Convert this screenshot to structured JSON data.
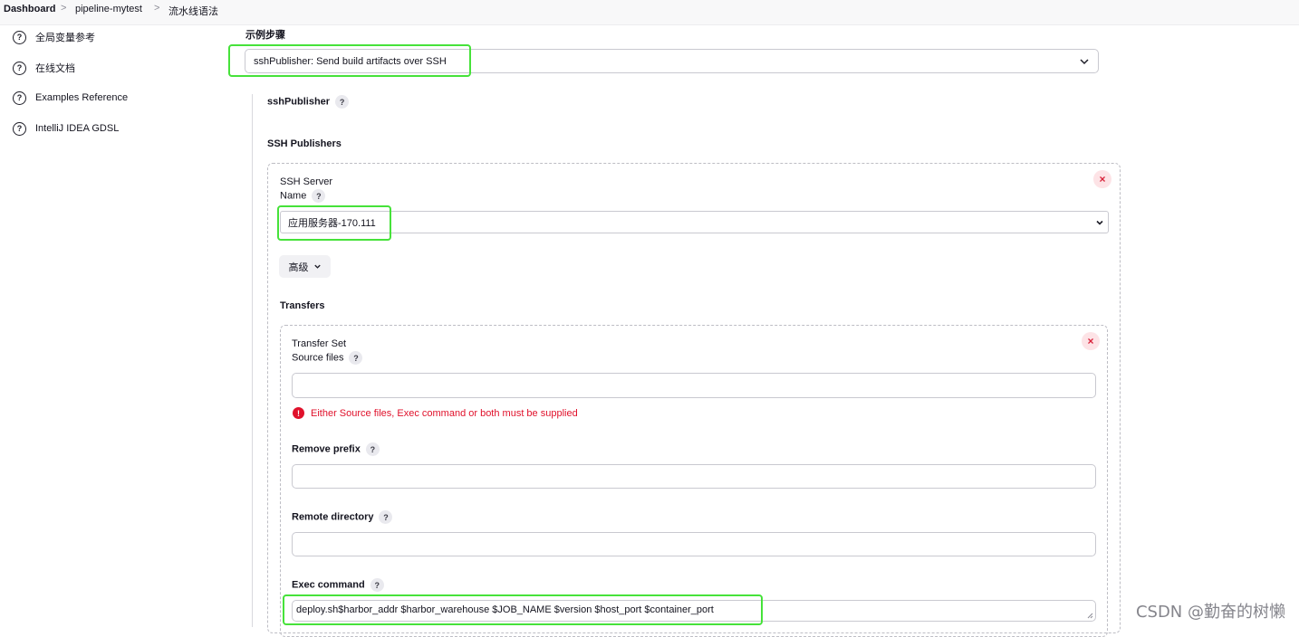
{
  "breadcrumb": {
    "items": [
      "Dashboard",
      "pipeline-mytest",
      "流水线语法"
    ],
    "separator": ">"
  },
  "sidebar": {
    "items": [
      {
        "label": "全局变量参考",
        "icon": "help-circle-icon"
      },
      {
        "label": "在线文档",
        "icon": "help-circle-icon"
      },
      {
        "label": "Examples Reference",
        "icon": "help-circle-icon"
      },
      {
        "label": "IntelliJ IDEA GDSL",
        "icon": "help-circle-icon"
      }
    ]
  },
  "sample_step": {
    "label": "示例步骤",
    "selected": "sshPublisher: Send build artifacts over SSH"
  },
  "form": {
    "step_name": "sshPublisher",
    "ssh_publishers_label": "SSH Publishers",
    "ssh_server": {
      "title": "SSH Server",
      "name_label": "Name",
      "name_value": "应用服务器-170.111",
      "advanced_label": "高级"
    },
    "transfers_label": "Transfers",
    "transfer_set": {
      "title": "Transfer Set",
      "source_files_label": "Source files",
      "source_files_value": "",
      "error_text": "Either Source files, Exec command or both must be supplied",
      "remove_prefix_label": "Remove prefix",
      "remove_prefix_value": "",
      "remote_directory_label": "Remote directory",
      "remote_directory_value": "",
      "exec_command_label": "Exec command",
      "exec_command_value": "deploy.sh$harbor_addr $harbor_warehouse $JOB_NAME $version $host_port $container_port"
    }
  },
  "help_glyph": "?",
  "close_glyph": "×",
  "error_glyph": "!",
  "watermark": "CSDN @勤奋的树懒",
  "colors": {
    "highlight": "#46e23a",
    "error": "#e0112b",
    "close_bg": "#fde3e6"
  }
}
